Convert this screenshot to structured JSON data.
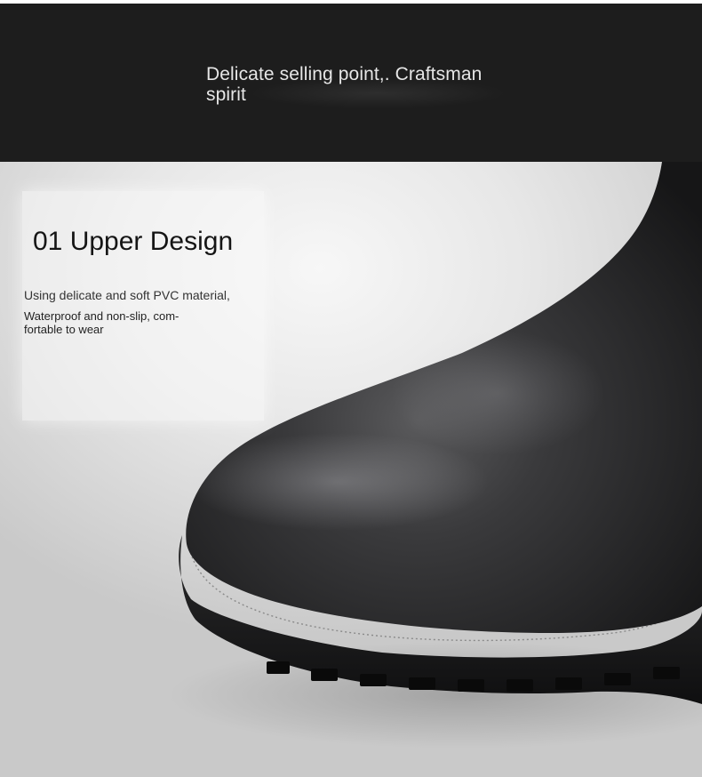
{
  "banner": {
    "title": "Delicate selling point,. Craftsman spirit"
  },
  "feature": {
    "title": "01 Upper Design",
    "line1": "Using delicate and soft PVC material,",
    "line2": "Waterproof and non-slip, com- fortable to wear"
  },
  "photo": {
    "subject": "black-rain-boot-toe",
    "colors": {
      "boot": "#2a2a2a",
      "background": "#e4e4e4",
      "banner": "#1d1d1d"
    }
  }
}
